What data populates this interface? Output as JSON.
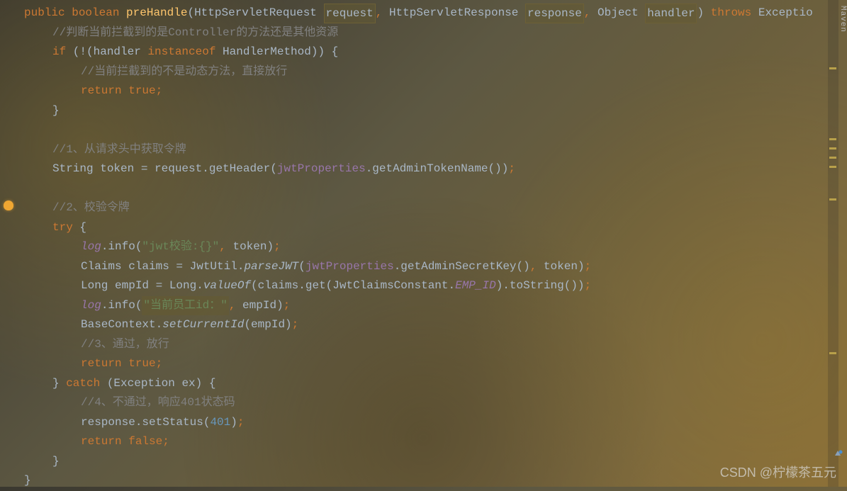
{
  "code": {
    "line1": {
      "public": "public",
      "boolean": "boolean",
      "method": "preHandle",
      "paren1": "(",
      "type1": "HttpServletRequest ",
      "param1": "request",
      "comma1": ",",
      "type2": " HttpServletResponse ",
      "param2": "response",
      "comma2": ",",
      "type3": " Object ",
      "param3": "handler",
      "paren2": ") ",
      "throws": "throws",
      "exc": " Exceptio"
    },
    "line2": {
      "comment": "//判断当前拦截到的是Controller的方法还是其他资源"
    },
    "line3": {
      "if": "if",
      "cond1": " (!(handler ",
      "instanceof": "instanceof",
      "cond2": " HandlerMethod)) {"
    },
    "line4": {
      "comment": "//当前拦截到的不是动态方法，直接放行"
    },
    "line5": {
      "return": "return",
      "true": " true",
      "semi": ";"
    },
    "line6": {
      "brace": "}"
    },
    "line8": {
      "comment": "//1、从请求头中获取令牌"
    },
    "line9": {
      "text1": "String token = request.getHeader(",
      "field": "jwtProperties",
      "text2": ".getAdminTokenName())",
      "semi": ";"
    },
    "line11": {
      "comment": "//2、校验令牌"
    },
    "line12": {
      "try": "try",
      "brace": " {"
    },
    "line13": {
      "log": "log",
      "text1": ".info(",
      "str": "\"jwt校验:{}\"",
      "comma": ",",
      "text2": " token)",
      "semi": ";"
    },
    "line14": {
      "text1": "Claims claims = JwtUtil.",
      "method": "parseJWT",
      "paren": "(",
      "field": "jwtProperties",
      "text2": ".getAdminSecretKey()",
      "comma": ",",
      "text3": " token)",
      "semi": ";"
    },
    "line15": {
      "text1": "Long empId = Long.",
      "method": "valueOf",
      "text2": "(claims.get(JwtClaimsConstant.",
      "field": "EMP_ID",
      "text3": ").toString())",
      "semi": ";"
    },
    "line16": {
      "log": "log",
      "text1": ".info(",
      "str": "\"当前员工id：\"",
      "comma": ",",
      "text2": " empId)",
      "semi": ";"
    },
    "line17": {
      "text1": "BaseContext.",
      "method": "setCurrentId",
      "text2": "(empId)",
      "semi": ";"
    },
    "line18": {
      "comment": "//3、通过，放行"
    },
    "line19": {
      "return": "return",
      "true": " true",
      "semi": ";"
    },
    "line20": {
      "brace": "} ",
      "catch": "catch",
      "text": " (Exception ex) {"
    },
    "line21": {
      "comment": "//4、不通过，响应401状态码"
    },
    "line22": {
      "text1": "response.setStatus(",
      "num": "401",
      "text2": ")",
      "semi": ";"
    },
    "line23": {
      "return": "return",
      "false": " false",
      "semi": ";"
    },
    "line24": {
      "brace": "}"
    },
    "line25": {
      "brace": "}"
    }
  },
  "sidebar": {
    "maven": "Maven"
  },
  "watermark": "CSDN @柠檬茶五元",
  "chart_data": null
}
